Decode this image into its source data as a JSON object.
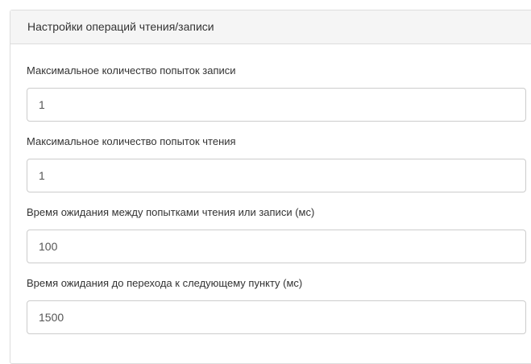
{
  "panel": {
    "title": "Настройки операций чтения/записи"
  },
  "fields": [
    {
      "label": "Максимальное количество попыток записи",
      "value": "1"
    },
    {
      "label": "Максимальное количество попыток чтения",
      "value": "1"
    },
    {
      "label": "Время ожидания между попытками чтения или записи (мс)",
      "value": "100"
    },
    {
      "label": "Время ожидания до перехода к следующему пункту (мс)",
      "value": "1500"
    }
  ]
}
